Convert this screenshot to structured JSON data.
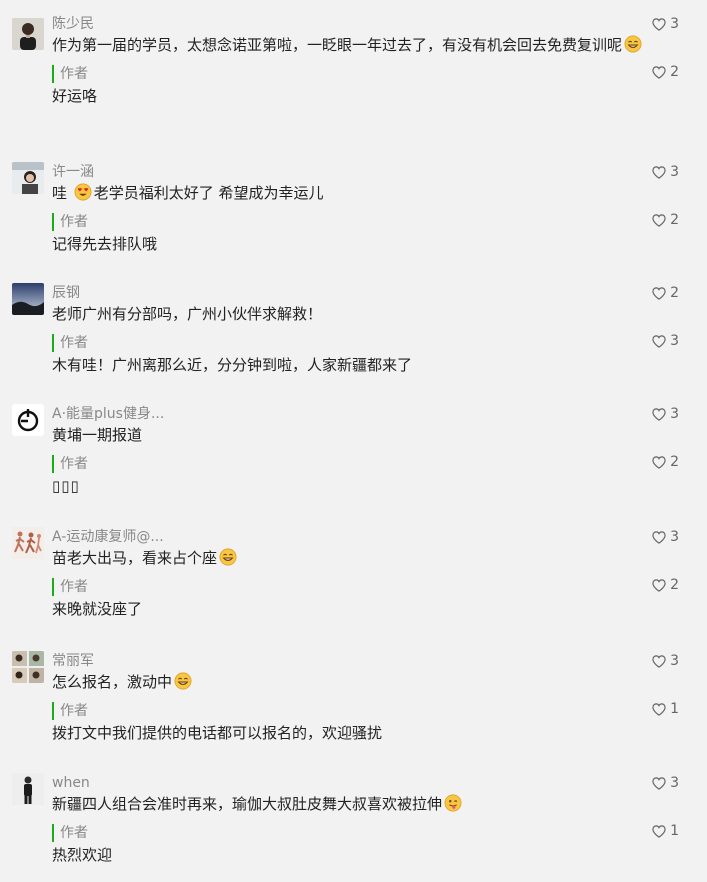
{
  "comments": [
    {
      "nickname": "陈少民",
      "text": "作为第一届的学员，太想念诺亚第啦，一眨眼一年过去了，有没有机会回去免费复训呢",
      "likes": "3",
      "reply": {
        "label": "作者",
        "text": "好运咯",
        "likes": "2"
      },
      "avatar_icon": "person-avatar-icon"
    },
    {
      "nickname": "许一涵",
      "text_before": "哇 ",
      "text_after": "老学员福利太好了  希望成为幸运儿",
      "likes": "3",
      "reply": {
        "label": "作者",
        "text": "记得先去排队哦",
        "likes": "2"
      },
      "avatar_icon": "photo-avatar-icon"
    },
    {
      "nickname": "辰钢",
      "text": "老师广州有分部吗，广州小伙伴求解救！",
      "likes": "2",
      "reply": {
        "label": "作者",
        "text": "木有哇！广州离那么近，分分钟到啦，人家新疆都来了",
        "likes": "3"
      },
      "avatar_icon": "landscape-avatar-icon"
    },
    {
      "nickname": "A·能量plus健身...",
      "text": "黄埔一期报道",
      "likes": "3",
      "reply": {
        "label": "作者",
        "text": "",
        "likes": "2"
      },
      "avatar_icon": "logo-avatar-icon"
    },
    {
      "nickname": "A-运动康复师@...",
      "text": "苗老大出马，看来占个座",
      "likes": "3",
      "reply": {
        "label": "作者",
        "text": "来晚就没座了",
        "likes": "2"
      },
      "avatar_icon": "runners-avatar-icon"
    },
    {
      "nickname": "常丽军",
      "text": "怎么报名，激动中",
      "likes": "3",
      "reply": {
        "label": "作者",
        "text": "拨打文中我们提供的电话都可以报名的，欢迎骚扰",
        "likes": "1"
      },
      "avatar_icon": "collage-avatar-icon"
    },
    {
      "nickname": "when",
      "text": "新疆四人组合会准时再来，瑜伽大叔肚皮舞大叔喜欢被拉伸",
      "likes": "3",
      "reply": {
        "label": "作者",
        "text": "热烈欢迎",
        "likes": "1"
      },
      "avatar_icon": "standing-person-avatar-icon"
    }
  ],
  "colors": {
    "accent": "#1aad19",
    "background": "#f2f2f2",
    "nickname": "#888888",
    "text": "#222222"
  }
}
